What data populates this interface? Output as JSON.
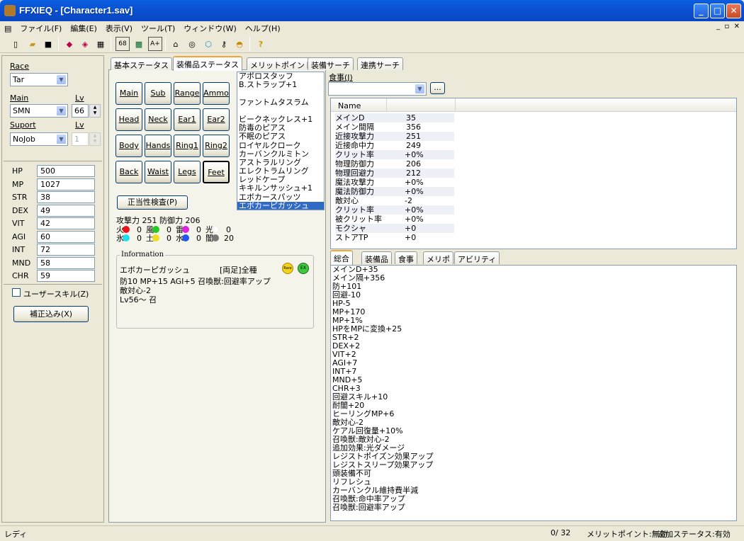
{
  "window": {
    "title": "FFXIEQ - [Character1.sav]"
  },
  "menu": [
    "ファイル(F)",
    "編集(E)",
    "表示(V)",
    "ツール(T)",
    "ウィンドウ(W)",
    "ヘルプ(H)"
  ],
  "toolbar": {
    "btn_68": "68",
    "btn_ah": "A+"
  },
  "left": {
    "race_label": "Race",
    "race_value": "Tar",
    "main_label": "Main",
    "main_value": "SMN",
    "lv_label": "Lv",
    "lv_value": "66",
    "support_label": "Suport",
    "support_value": "NoJob",
    "lv2_label": "Lv",
    "lv2_value": "1",
    "stats": [
      {
        "k": "HP",
        "v": "500"
      },
      {
        "k": "MP",
        "v": "1027"
      },
      {
        "k": "STR",
        "v": "38"
      },
      {
        "k": "DEX",
        "v": "49"
      },
      {
        "k": "VIT",
        "v": "42"
      },
      {
        "k": "AGI",
        "v": "60"
      },
      {
        "k": "INT",
        "v": "72"
      },
      {
        "k": "MND",
        "v": "58"
      },
      {
        "k": "CHR",
        "v": "59"
      }
    ],
    "user_skill": "ユーザースキル(Z)",
    "corrected_btn": "補正込み(X)"
  },
  "tabs": [
    "基本ステータス",
    "装備品ステータス",
    "メリットポイント",
    "装備サーチ",
    "連携サーチ"
  ],
  "slots": [
    "Main",
    "Sub",
    "Range",
    "Ammo",
    "Head",
    "Neck",
    "Ear1",
    "Ear2",
    "Body",
    "Hands",
    "Ring1",
    "Ring2",
    "Back",
    "Waist",
    "Legs",
    "Feet"
  ],
  "items": [
    "アポロスタッフ",
    "B.ストラップ+1",
    "",
    "ファントムタスラム",
    "",
    "ビークネックレス+1",
    "防毒のピアス",
    "不眠のピアス",
    "ロイヤルクローク",
    "カーバンクルミトン",
    "アストラルリング",
    "エレクトラムリング",
    "レッドケープ",
    "キキルンサッシュ+1",
    "エボカースパッツ",
    "エボカーピガッシュ"
  ],
  "validate_btn": "正当性検査(P)",
  "attack_line": "攻撃力 251 防御力 206",
  "elements": [
    {
      "n": "火",
      "v": "0",
      "c": "#e8141a"
    },
    {
      "n": "風",
      "v": "0",
      "c": "#22cc22"
    },
    {
      "n": "雷",
      "v": "0",
      "c": "#dd22dd"
    },
    {
      "n": "光",
      "v": "0",
      "c": "#ffffff"
    },
    {
      "n": "氷",
      "v": "0",
      "c": "#22ddee"
    },
    {
      "n": "土",
      "v": "0",
      "c": "#eedd22"
    },
    {
      "n": "水",
      "v": "0",
      "c": "#2255ee"
    },
    {
      "n": "闇",
      "v": "20",
      "c": "#777777"
    }
  ],
  "info": {
    "title": "Information",
    "name": "エボカーピガッシュ",
    "tag": "[両足]全種",
    "line2": "防10 MP+15 AGI+5 召喚獣:回避率アップ",
    "line3": "敵対心-2",
    "line4": "Lv56～ 召",
    "badge1": "Rare",
    "badge2": "EX"
  },
  "food": {
    "label": "食事(J)",
    "btn": "..."
  },
  "stat_header": "Name",
  "stat_rows": [
    {
      "k": "メインD",
      "v": "35"
    },
    {
      "k": "メイン間隔",
      "v": "356"
    },
    {
      "k": "近接攻撃力",
      "v": "251"
    },
    {
      "k": "近接命中力",
      "v": "249"
    },
    {
      "k": "クリット率",
      "v": "+0%"
    },
    {
      "k": "物理防御力",
      "v": "206"
    },
    {
      "k": "物理回避力",
      "v": "212"
    },
    {
      "k": "魔法攻撃力",
      "v": "+0%"
    },
    {
      "k": "魔法防御力",
      "v": "+0%"
    },
    {
      "k": "敵対心",
      "v": "-2"
    },
    {
      "k": "クリット率",
      "v": "+0%"
    },
    {
      "k": "被クリット率",
      "v": "+0%"
    },
    {
      "k": "モクシャ",
      "v": "+0"
    },
    {
      "k": "ストアTP",
      "v": "+0"
    }
  ],
  "btabs": [
    "総合",
    "装備品",
    "食事",
    "メリポ",
    "アビリティ"
  ],
  "summary": [
    "メインD+35",
    "メイン隔+356",
    "防+101",
    "回避-10",
    "HP-5",
    "MP+170",
    "MP+1%",
    "HPをMPに変換+25",
    "STR+2",
    "DEX+2",
    "VIT+2",
    "AGI+7",
    "INT+7",
    "MND+5",
    "CHR+3",
    "回避スキル+10",
    "耐闇+20",
    "ヒーリングMP+6",
    "敵対心-2",
    "ケアル回復量+10%",
    "召喚獣:敵対心-2",
    "追加効果:光ダメージ",
    "レジストポイズン効果アップ",
    "レジストスリープ効果アップ",
    "頭装備不可",
    "リフレシュ",
    "カーバンクル維持費半減",
    "召喚獣:命中率アップ",
    "召喚獣:回避率アップ"
  ],
  "status": {
    "left": "レディ",
    "count": "0/ 32",
    "merit": "メリットポイント:無効",
    "extra": "追加ステータス:有効"
  }
}
